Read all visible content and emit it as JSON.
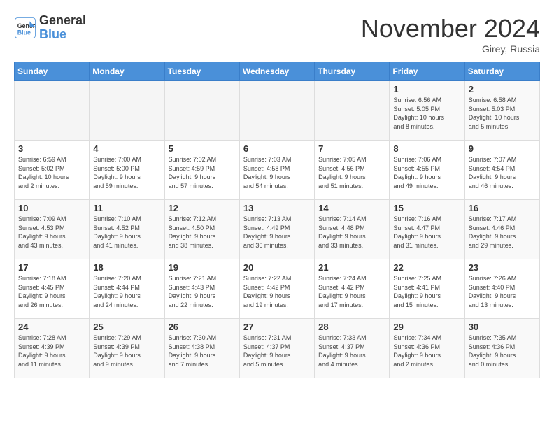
{
  "header": {
    "logo_line1": "General",
    "logo_line2": "Blue",
    "month": "November 2024",
    "location": "Girey, Russia"
  },
  "weekdays": [
    "Sunday",
    "Monday",
    "Tuesday",
    "Wednesday",
    "Thursday",
    "Friday",
    "Saturday"
  ],
  "weeks": [
    [
      {
        "day": "",
        "info": ""
      },
      {
        "day": "",
        "info": ""
      },
      {
        "day": "",
        "info": ""
      },
      {
        "day": "",
        "info": ""
      },
      {
        "day": "",
        "info": ""
      },
      {
        "day": "1",
        "info": "Sunrise: 6:56 AM\nSunset: 5:05 PM\nDaylight: 10 hours\nand 8 minutes."
      },
      {
        "day": "2",
        "info": "Sunrise: 6:58 AM\nSunset: 5:03 PM\nDaylight: 10 hours\nand 5 minutes."
      }
    ],
    [
      {
        "day": "3",
        "info": "Sunrise: 6:59 AM\nSunset: 5:02 PM\nDaylight: 10 hours\nand 2 minutes."
      },
      {
        "day": "4",
        "info": "Sunrise: 7:00 AM\nSunset: 5:00 PM\nDaylight: 9 hours\nand 59 minutes."
      },
      {
        "day": "5",
        "info": "Sunrise: 7:02 AM\nSunset: 4:59 PM\nDaylight: 9 hours\nand 57 minutes."
      },
      {
        "day": "6",
        "info": "Sunrise: 7:03 AM\nSunset: 4:58 PM\nDaylight: 9 hours\nand 54 minutes."
      },
      {
        "day": "7",
        "info": "Sunrise: 7:05 AM\nSunset: 4:56 PM\nDaylight: 9 hours\nand 51 minutes."
      },
      {
        "day": "8",
        "info": "Sunrise: 7:06 AM\nSunset: 4:55 PM\nDaylight: 9 hours\nand 49 minutes."
      },
      {
        "day": "9",
        "info": "Sunrise: 7:07 AM\nSunset: 4:54 PM\nDaylight: 9 hours\nand 46 minutes."
      }
    ],
    [
      {
        "day": "10",
        "info": "Sunrise: 7:09 AM\nSunset: 4:53 PM\nDaylight: 9 hours\nand 43 minutes."
      },
      {
        "day": "11",
        "info": "Sunrise: 7:10 AM\nSunset: 4:52 PM\nDaylight: 9 hours\nand 41 minutes."
      },
      {
        "day": "12",
        "info": "Sunrise: 7:12 AM\nSunset: 4:50 PM\nDaylight: 9 hours\nand 38 minutes."
      },
      {
        "day": "13",
        "info": "Sunrise: 7:13 AM\nSunset: 4:49 PM\nDaylight: 9 hours\nand 36 minutes."
      },
      {
        "day": "14",
        "info": "Sunrise: 7:14 AM\nSunset: 4:48 PM\nDaylight: 9 hours\nand 33 minutes."
      },
      {
        "day": "15",
        "info": "Sunrise: 7:16 AM\nSunset: 4:47 PM\nDaylight: 9 hours\nand 31 minutes."
      },
      {
        "day": "16",
        "info": "Sunrise: 7:17 AM\nSunset: 4:46 PM\nDaylight: 9 hours\nand 29 minutes."
      }
    ],
    [
      {
        "day": "17",
        "info": "Sunrise: 7:18 AM\nSunset: 4:45 PM\nDaylight: 9 hours\nand 26 minutes."
      },
      {
        "day": "18",
        "info": "Sunrise: 7:20 AM\nSunset: 4:44 PM\nDaylight: 9 hours\nand 24 minutes."
      },
      {
        "day": "19",
        "info": "Sunrise: 7:21 AM\nSunset: 4:43 PM\nDaylight: 9 hours\nand 22 minutes."
      },
      {
        "day": "20",
        "info": "Sunrise: 7:22 AM\nSunset: 4:42 PM\nDaylight: 9 hours\nand 19 minutes."
      },
      {
        "day": "21",
        "info": "Sunrise: 7:24 AM\nSunset: 4:42 PM\nDaylight: 9 hours\nand 17 minutes."
      },
      {
        "day": "22",
        "info": "Sunrise: 7:25 AM\nSunset: 4:41 PM\nDaylight: 9 hours\nand 15 minutes."
      },
      {
        "day": "23",
        "info": "Sunrise: 7:26 AM\nSunset: 4:40 PM\nDaylight: 9 hours\nand 13 minutes."
      }
    ],
    [
      {
        "day": "24",
        "info": "Sunrise: 7:28 AM\nSunset: 4:39 PM\nDaylight: 9 hours\nand 11 minutes."
      },
      {
        "day": "25",
        "info": "Sunrise: 7:29 AM\nSunset: 4:39 PM\nDaylight: 9 hours\nand 9 minutes."
      },
      {
        "day": "26",
        "info": "Sunrise: 7:30 AM\nSunset: 4:38 PM\nDaylight: 9 hours\nand 7 minutes."
      },
      {
        "day": "27",
        "info": "Sunrise: 7:31 AM\nSunset: 4:37 PM\nDaylight: 9 hours\nand 5 minutes."
      },
      {
        "day": "28",
        "info": "Sunrise: 7:33 AM\nSunset: 4:37 PM\nDaylight: 9 hours\nand 4 minutes."
      },
      {
        "day": "29",
        "info": "Sunrise: 7:34 AM\nSunset: 4:36 PM\nDaylight: 9 hours\nand 2 minutes."
      },
      {
        "day": "30",
        "info": "Sunrise: 7:35 AM\nSunset: 4:36 PM\nDaylight: 9 hours\nand 0 minutes."
      }
    ]
  ]
}
